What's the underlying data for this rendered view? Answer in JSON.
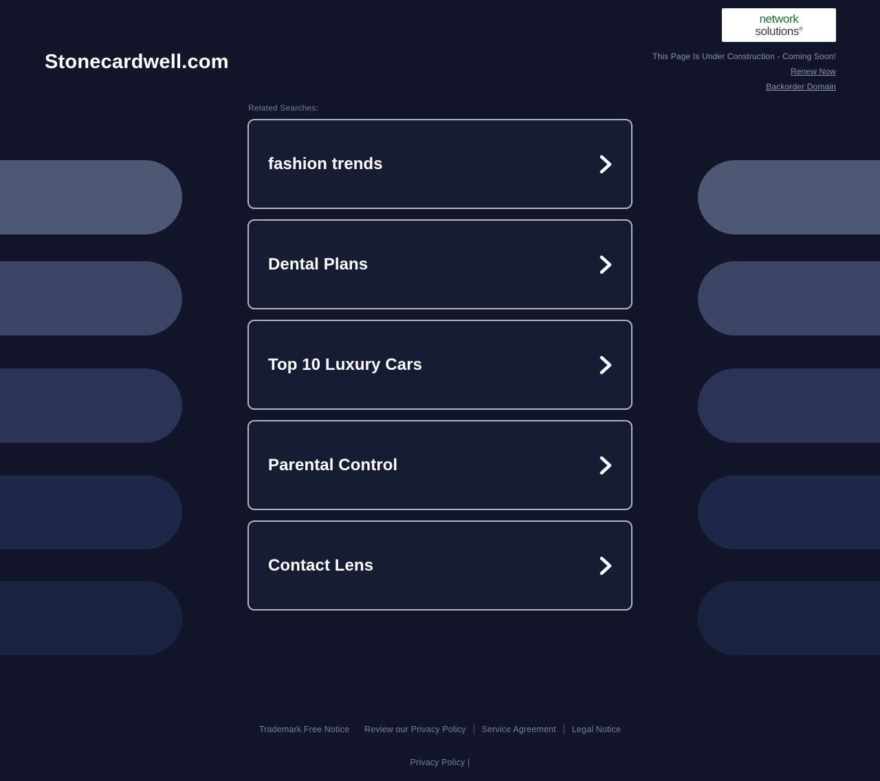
{
  "header": {
    "domain_title": "Stonecardwell.com",
    "logo": {
      "name_top": "network",
      "name_bottom": "solutions",
      "registered_mark": "®"
    },
    "construction_notice": "This Page Is Under Construction - Coming Soon!",
    "renew_link": "Renew Now",
    "backorder_link": "Backorder Domain"
  },
  "main": {
    "related_label": "Related Searches:",
    "cards": [
      {
        "title": "fashion trends",
        "icon": "chevron-right-icon"
      },
      {
        "title": "Dental Plans",
        "icon": "chevron-right-icon"
      },
      {
        "title": "Top 10 Luxury Cars",
        "icon": "chevron-right-icon"
      },
      {
        "title": "Parental Control",
        "icon": "chevron-right-icon"
      },
      {
        "title": "Contact Lens",
        "icon": "chevron-right-icon"
      }
    ]
  },
  "footer": {
    "links": [
      "Trademark Free Notice",
      "Review our Privacy Policy",
      "Service Agreement",
      "Legal Notice"
    ],
    "bottom_text": "Privacy Policy |"
  },
  "colors": {
    "page_background": "#111729",
    "card_background": "#161c33",
    "card_border": "#b4b7bd",
    "title_text": "#ffffff",
    "muted_text": "#767f9a",
    "header_muted_text": "#8d95ad",
    "logo_green": "#1f6b35",
    "logo_dark": "#3b3b3b",
    "pill_1": "#4e5773",
    "pill_2": "#3b4463",
    "pill_3": "#2b3456",
    "pill_4": "#1e2747",
    "pill_5": "#1a2340"
  }
}
